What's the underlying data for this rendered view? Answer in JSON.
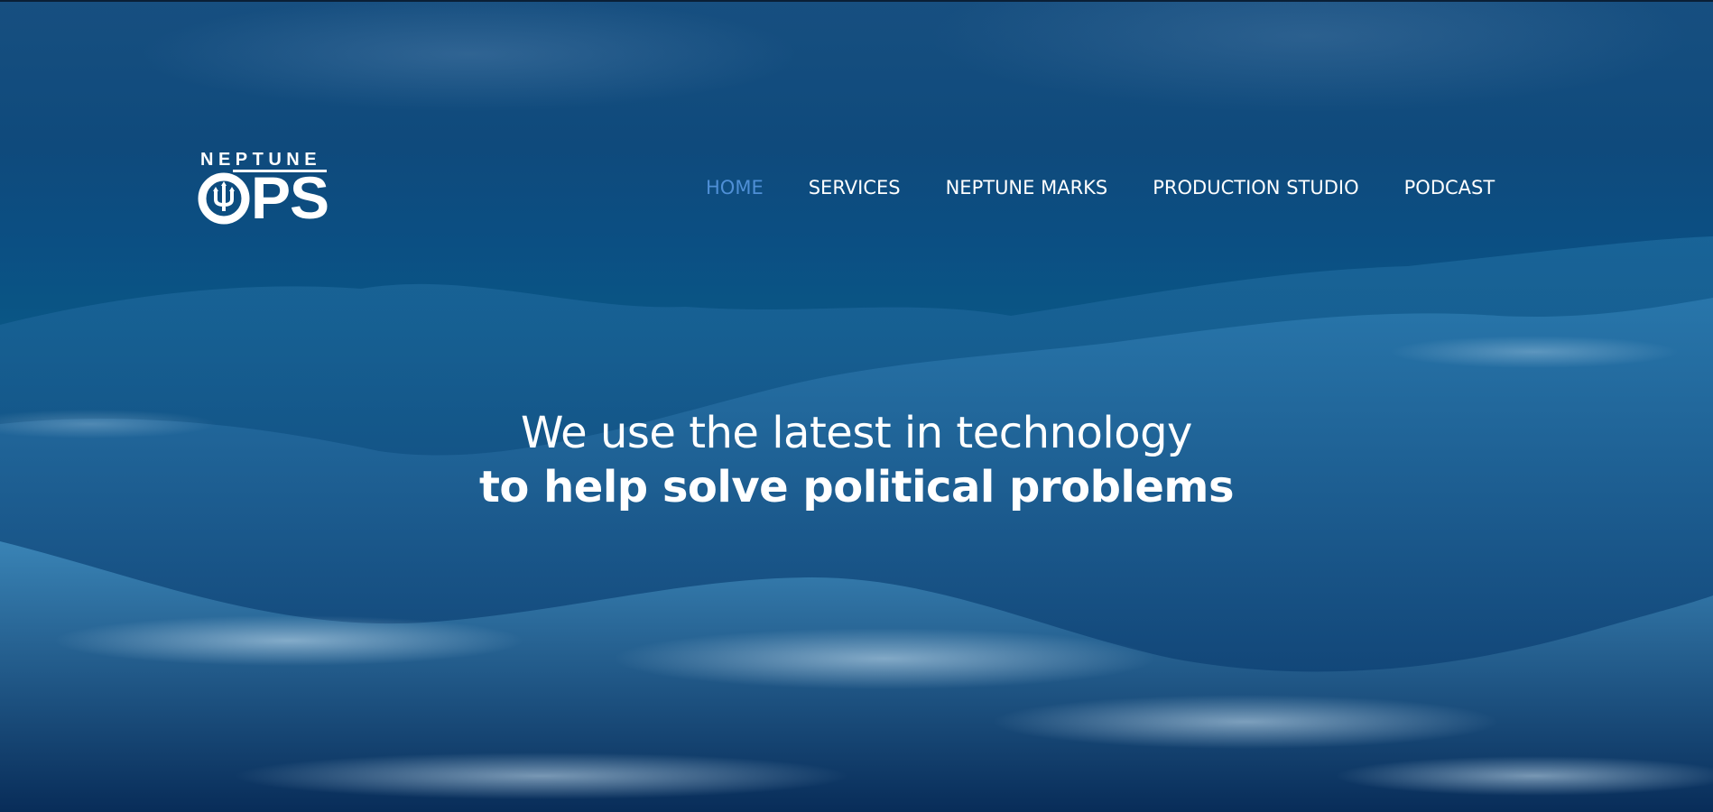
{
  "brand": {
    "logo_top": "NEPTUNE",
    "logo_bottom": "PS",
    "logo_mark_icon": "trident-in-circle-icon"
  },
  "nav": {
    "items": [
      {
        "label": "HOME",
        "active": true
      },
      {
        "label": "SERVICES",
        "active": false
      },
      {
        "label": "NEPTUNE MARKS",
        "active": false
      },
      {
        "label": "PRODUCTION STUDIO",
        "active": false
      },
      {
        "label": "PODCAST",
        "active": false
      }
    ]
  },
  "hero": {
    "line1": "We use the latest in technology",
    "line2": "to help solve political problems",
    "background": "ocean-waves-image"
  },
  "colors": {
    "nav_active": "#4f8fd6",
    "nav_text": "#ffffff",
    "ocean_deep": "#0a2f5e",
    "ocean_mid": "#0a5685"
  }
}
